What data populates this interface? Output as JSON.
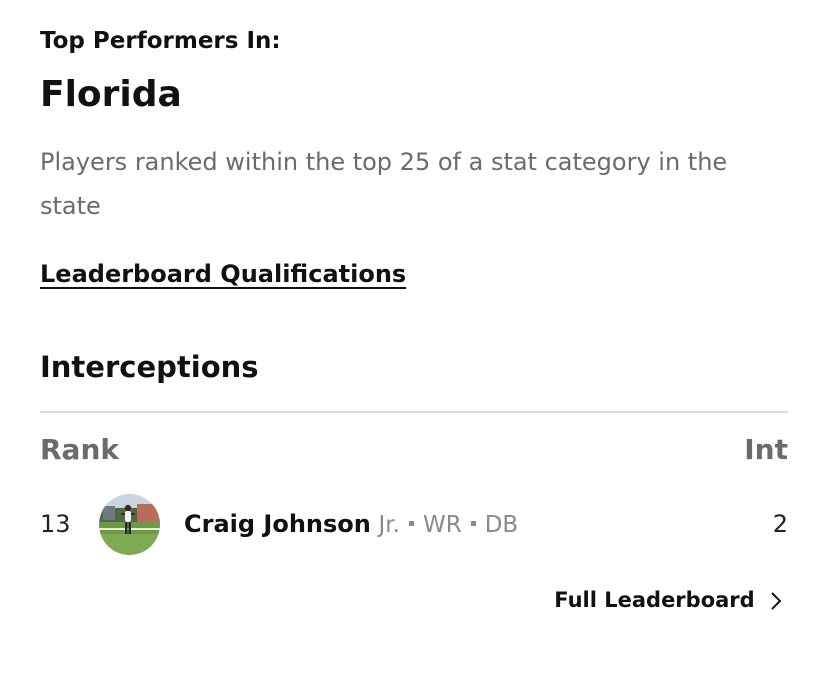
{
  "header": {
    "kicker": "Top Performers In:",
    "state": "Florida",
    "description": "Players ranked within the top 25 of a stat category in the state",
    "qualifications_link": "Leaderboard Qualifications"
  },
  "category": {
    "title": "Interceptions",
    "columns": {
      "rank": "Rank",
      "stat": "Int"
    },
    "rows": [
      {
        "rank": "13",
        "name": "Craig Johnson",
        "year": "Jr.",
        "position_1": "WR",
        "position_2": "DB",
        "value": "2"
      }
    ],
    "full_leaderboard_link": "Full Leaderboard"
  },
  "icons": {
    "avatar": "player-photo",
    "chevron": "chevron-right-icon"
  }
}
